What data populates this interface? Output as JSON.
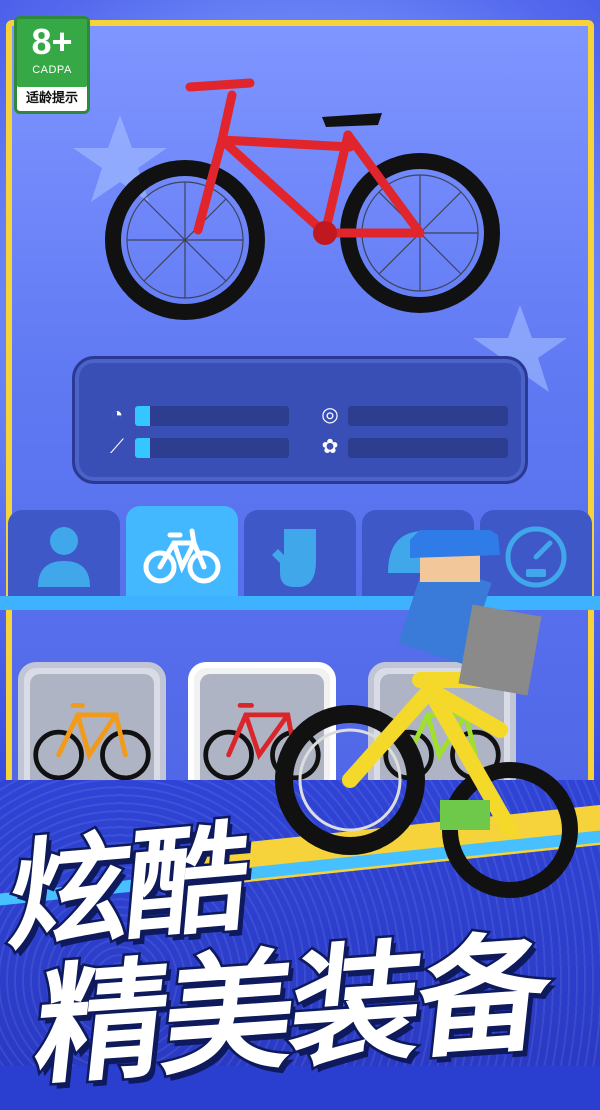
{
  "age_rating": {
    "number": "8+",
    "org": "CADPA",
    "label": "适龄提示"
  },
  "colors": {
    "accent_yellow": "#f6d33a",
    "bar_fill": "#33c6ff",
    "tab_active": "#43b8ff",
    "panel": "#3a4fb6"
  },
  "stats": [
    {
      "icon": "speed-gauge-icon",
      "level": 0.1
    },
    {
      "icon": "coins-icon",
      "level": 0.0
    },
    {
      "icon": "terrain-icon",
      "level": 0.1
    },
    {
      "icon": "medal-icon",
      "level": 0.0
    }
  ],
  "tabs": [
    {
      "icon": "rider-icon",
      "active": false
    },
    {
      "icon": "bike-icon",
      "active": true
    },
    {
      "icon": "glove-icon",
      "active": false
    },
    {
      "icon": "helmet-icon",
      "active": false
    },
    {
      "icon": "speedometer-icon",
      "active": false
    }
  ],
  "bike_slots": [
    {
      "color": "#f29a1a",
      "selected": false
    },
    {
      "color": "#d8262b",
      "selected": true
    },
    {
      "color": "#9fe02a",
      "selected": false
    }
  ],
  "preview_bike": {
    "color": "#e0262c"
  },
  "slogan": {
    "line1": "炫酷",
    "line2": "精美装备"
  }
}
